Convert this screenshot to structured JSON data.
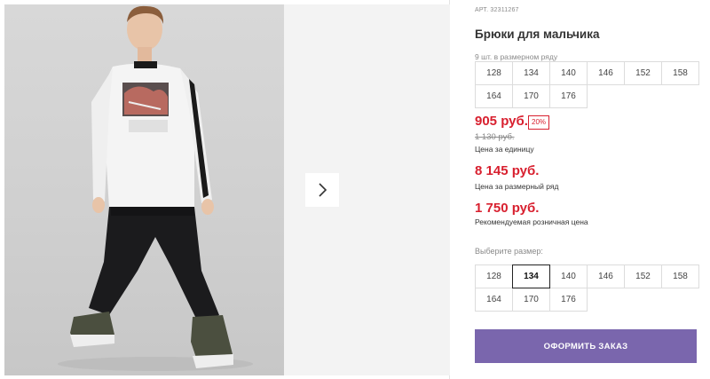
{
  "product": {
    "article": "АРТ. 32311267",
    "title": "Брюки для мальчика",
    "quantity_note": "9 шт. в размерном ряду"
  },
  "size_set": {
    "sizes": [
      "128",
      "134",
      "140",
      "146",
      "152",
      "158",
      "164",
      "170",
      "176"
    ]
  },
  "pricing": {
    "unit_price": "905 руб.",
    "discount": "20%",
    "old_price": "1 130 руб.",
    "unit_label": "Цена за единицу",
    "set_price": "8 145 руб.",
    "set_label": "Цена за размерный ряд",
    "rrp_price": "1 750 руб.",
    "rrp_label": "Рекомендуемая розничная цена",
    "accent_color": "#d8202f"
  },
  "size_selector": {
    "label": "Выберите размер:",
    "sizes": [
      "128",
      "134",
      "140",
      "146",
      "152",
      "158",
      "164",
      "170",
      "176"
    ],
    "selected": "134"
  },
  "actions": {
    "order_label": "ОФОРМИТЬ ЗАКАЗ",
    "order_color": "#7a66ad"
  },
  "gallery": {
    "next_icon": "chevron-right-icon",
    "image_subject": "product-photo"
  }
}
